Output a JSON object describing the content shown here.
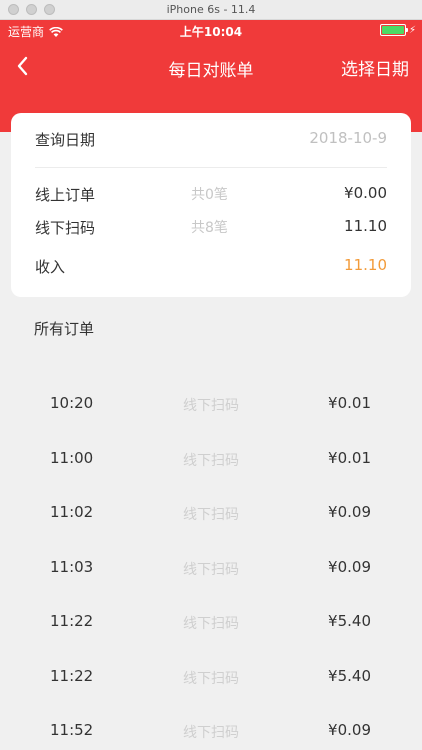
{
  "simulator": {
    "title": "iPhone 6s - 11.4"
  },
  "status_bar": {
    "carrier": "运营商",
    "time": "上午10:04"
  },
  "navbar": {
    "title": "每日对账单",
    "right_action": "选择日期"
  },
  "summary": {
    "query_date": {
      "label": "查询日期",
      "value": "2018-10-9"
    },
    "online": {
      "label": "线上订单",
      "count": "共0笔",
      "amount": "¥0.00"
    },
    "offline": {
      "label": "线下扫码",
      "count": "共8笔",
      "amount": "11.10"
    },
    "income": {
      "label": "收入",
      "amount": "11.10"
    }
  },
  "orders_title": "所有订单",
  "orders": [
    {
      "time": "10:20",
      "type": "线下扫码",
      "amount": "¥0.01"
    },
    {
      "time": "11:00",
      "type": "线下扫码",
      "amount": "¥0.01"
    },
    {
      "time": "11:02",
      "type": "线下扫码",
      "amount": "¥0.09"
    },
    {
      "time": "11:03",
      "type": "线下扫码",
      "amount": "¥0.09"
    },
    {
      "time": "11:22",
      "type": "线下扫码",
      "amount": "¥5.40"
    },
    {
      "time": "11:22",
      "type": "线下扫码",
      "amount": "¥5.40"
    },
    {
      "time": "11:52",
      "type": "线下扫码",
      "amount": "¥0.09"
    }
  ],
  "colors": {
    "header": "#f03a3a",
    "income": "#f29b3a",
    "battery": "#4cd964"
  }
}
